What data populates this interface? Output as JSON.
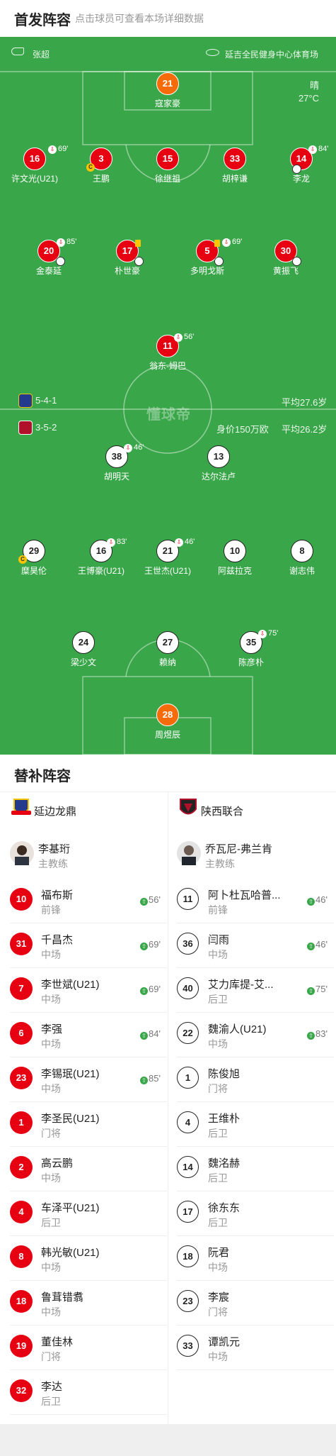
{
  "header": {
    "title": "首发阵容",
    "subtitle": "点击球员可查看本场详细数据"
  },
  "match": {
    "referee": "张超",
    "venue": "延吉全民健身中心体育场",
    "weather": "晴",
    "temperature": "27°C",
    "watermark": "懂球帝"
  },
  "home": {
    "name": "延边龙鼎",
    "formation": "5-4-1",
    "avg_age": "平均27.6岁",
    "color": "#e60012",
    "players": [
      {
        "num": "21",
        "name": "寇家豪",
        "kind": "orange"
      },
      {
        "num": "16",
        "name": "许文光(U21)",
        "kind": "red",
        "sub": "69'"
      },
      {
        "num": "3",
        "name": "王鹏",
        "kind": "red",
        "captain": "C"
      },
      {
        "num": "15",
        "name": "徐继祖",
        "kind": "red"
      },
      {
        "num": "33",
        "name": "胡梓谦",
        "kind": "red"
      },
      {
        "num": "14",
        "name": "李龙",
        "kind": "red",
        "sub": "84'"
      },
      {
        "num": "20",
        "name": "金泰延",
        "kind": "red",
        "sub": "85'"
      },
      {
        "num": "17",
        "name": "朴世豪",
        "kind": "red"
      },
      {
        "num": "5",
        "name": "多明戈斯",
        "kind": "red",
        "sub": "69'"
      },
      {
        "num": "30",
        "name": "黄振飞",
        "kind": "red"
      },
      {
        "num": "11",
        "name": "翁东-姆巴",
        "kind": "red",
        "sub": "56'"
      }
    ]
  },
  "away": {
    "name": "陕西联合",
    "formation": "3-5-2",
    "value": "身价150万欧",
    "avg_age": "平均26.2岁",
    "color": "#ffffff",
    "players": [
      {
        "num": "38",
        "name": "胡明天",
        "kind": "white",
        "sub": "46'"
      },
      {
        "num": "13",
        "name": "达尔法卢",
        "kind": "white"
      },
      {
        "num": "29",
        "name": "糜昊伦",
        "kind": "white",
        "captain": "C"
      },
      {
        "num": "16",
        "name": "王博豪(U21)",
        "kind": "white",
        "sub": "83'"
      },
      {
        "num": "21",
        "name": "王世杰(U21)",
        "kind": "white",
        "sub": "46'"
      },
      {
        "num": "10",
        "name": "阿兹拉克",
        "kind": "white"
      },
      {
        "num": "8",
        "name": "谢志伟",
        "kind": "white"
      },
      {
        "num": "24",
        "name": "梁少文",
        "kind": "white"
      },
      {
        "num": "27",
        "name": "赖纳",
        "kind": "white"
      },
      {
        "num": "35",
        "name": "陈彦朴",
        "kind": "white",
        "sub": "75'"
      },
      {
        "num": "28",
        "name": "周煜辰",
        "kind": "orange"
      }
    ]
  },
  "subs": {
    "title": "替补阵容",
    "home_team": "延边龙鼎",
    "away_team": "陕西联合",
    "home_coach": {
      "name": "李基珩",
      "role": "主教练"
    },
    "away_coach": {
      "name": "乔瓦尼-弗兰肯",
      "role": "主教练"
    },
    "home": [
      {
        "num": "10",
        "name": "福布斯",
        "pos": "前锋",
        "in": "56'"
      },
      {
        "num": "31",
        "name": "千昌杰",
        "pos": "中场",
        "in": "69'"
      },
      {
        "num": "7",
        "name": "李世斌(U21)",
        "pos": "中场",
        "in": "69'"
      },
      {
        "num": "6",
        "name": "李强",
        "pos": "中场",
        "in": "84'"
      },
      {
        "num": "23",
        "name": "李锡珉(U21)",
        "pos": "中场",
        "in": "85'"
      },
      {
        "num": "1",
        "name": "李圣民(U21)",
        "pos": "门将"
      },
      {
        "num": "2",
        "name": "高云鹏",
        "pos": "中场"
      },
      {
        "num": "4",
        "name": "车泽平(U21)",
        "pos": "后卫"
      },
      {
        "num": "8",
        "name": "韩光敏(U21)",
        "pos": "中场"
      },
      {
        "num": "18",
        "name": "鲁茸错翥",
        "pos": "中场"
      },
      {
        "num": "19",
        "name": "董佳林",
        "pos": "门将"
      },
      {
        "num": "32",
        "name": "李达",
        "pos": "后卫"
      }
    ],
    "away": [
      {
        "num": "11",
        "name": "阿卜杜瓦哈普...",
        "pos": "前锋",
        "in": "46'"
      },
      {
        "num": "36",
        "name": "闫雨",
        "pos": "中场",
        "in": "46'"
      },
      {
        "num": "40",
        "name": "艾力库提-艾...",
        "pos": "后卫",
        "in": "75'"
      },
      {
        "num": "22",
        "name": "魏渝人(U21)",
        "pos": "中场",
        "in": "83'"
      },
      {
        "num": "1",
        "name": "陈俊旭",
        "pos": "门将"
      },
      {
        "num": "4",
        "name": "王维朴",
        "pos": "后卫"
      },
      {
        "num": "14",
        "name": "魏洺赫",
        "pos": "后卫"
      },
      {
        "num": "17",
        "name": "徐东东",
        "pos": "后卫"
      },
      {
        "num": "18",
        "name": "阮君",
        "pos": "中场"
      },
      {
        "num": "23",
        "name": "李宸",
        "pos": "门将"
      },
      {
        "num": "33",
        "name": "谭凯元",
        "pos": "中场"
      }
    ]
  }
}
